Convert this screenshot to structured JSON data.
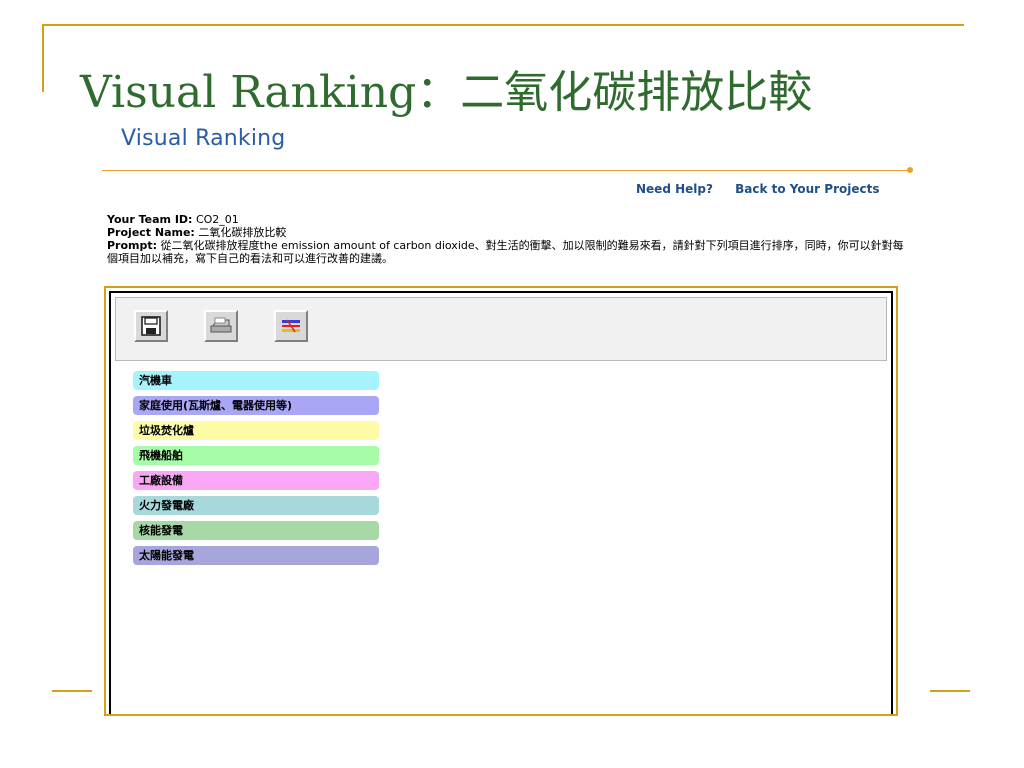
{
  "slide": {
    "title": "Visual Ranking：二氧化碳排放比較",
    "logo_text": "Visual Ranking"
  },
  "nav": {
    "help_link": "Need Help?",
    "back_link": "Back to Your Projects"
  },
  "info": {
    "team_id_label": "Your Team ID:",
    "team_id_value": "CO2_01",
    "project_name_label": "Project Name:",
    "project_name_value": "二氧化碳排放比較",
    "prompt_label": "Prompt:",
    "prompt_value": "從二氧化碳排放程度the emission amount of carbon dioxide、對生活的衝擊、加以限制的難易來看，請針對下列項目進行排序，同時，你可以針對每個項目加以補充，寫下自己的看法和可以進行改善的建議。"
  },
  "toolbar": {
    "icons": [
      "save-icon",
      "print-icon",
      "compare-icon"
    ]
  },
  "items": [
    {
      "label": "汽機車",
      "color": "#a6f4fb"
    },
    {
      "label": "家庭使用(瓦斯爐、電器使用等)",
      "color": "#a9a6f5"
    },
    {
      "label": "垃圾焚化爐",
      "color": "#fdfba5"
    },
    {
      "label": "飛機船舶",
      "color": "#a7fca7"
    },
    {
      "label": "工廠設備",
      "color": "#f9a6f5"
    },
    {
      "label": "火力發電廠",
      "color": "#a6d8dc"
    },
    {
      "label": "核能發電",
      "color": "#a6d9a6"
    },
    {
      "label": "太陽能發電",
      "color": "#a6a6dc"
    }
  ],
  "colors": {
    "accent": "#d4a017",
    "title_green": "#2f6b2f",
    "link_blue": "#1f4f8a",
    "logo_blue": "#2b5ca8"
  }
}
